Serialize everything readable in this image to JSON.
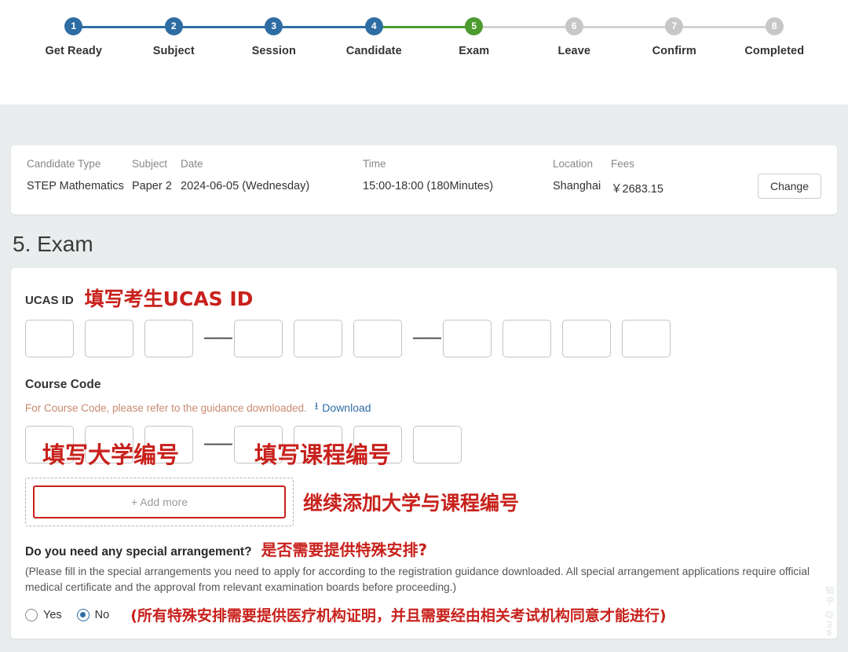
{
  "stepper": {
    "steps": [
      {
        "num": "1",
        "label": "Get Ready",
        "state": "done"
      },
      {
        "num": "2",
        "label": "Subject",
        "state": "done"
      },
      {
        "num": "3",
        "label": "Session",
        "state": "done"
      },
      {
        "num": "4",
        "label": "Candidate",
        "state": "done"
      },
      {
        "num": "5",
        "label": "Exam",
        "state": "current"
      },
      {
        "num": "6",
        "label": "Leave",
        "state": "todo"
      },
      {
        "num": "7",
        "label": "Confirm",
        "state": "todo"
      },
      {
        "num": "8",
        "label": "Completed",
        "state": "todo"
      }
    ],
    "colors": {
      "done": "#2e6da4",
      "current": "#4b9b2f",
      "todo": "#c7c7c7"
    }
  },
  "info": {
    "candidate_type_label": "Candidate Type",
    "candidate_type_value": "STEP Mathematics",
    "subject_label": "Subject",
    "subject_value": "Paper 2",
    "date_label": "Date",
    "date_value": "2024-06-05 (Wednesday)",
    "time_label": "Time",
    "time_value": "15:00-18:00 (180Minutes)",
    "location_label": "Location",
    "location_value": "Shanghai",
    "fees_label": "Fees",
    "fees_value": "￥2683.15",
    "change_button": "Change"
  },
  "section": {
    "title": "5. Exam"
  },
  "ucas": {
    "label": "UCAS ID",
    "annotation": "填写考生UCAS ID",
    "segments": [
      3,
      3,
      4
    ],
    "separator": "—",
    "values": [
      "",
      "",
      "",
      "",
      "",
      "",
      "",
      "",
      "",
      ""
    ]
  },
  "course_code": {
    "label": "Course Code",
    "hint": "For Course Code, please refer to the guidance downloaded.",
    "download_label": "Download",
    "download_icon": "download-icon",
    "segments": [
      3,
      4
    ],
    "separator": "—",
    "values": [
      "",
      "",
      "",
      "",
      "",
      "",
      ""
    ],
    "annotation_university": "填写大学编号",
    "annotation_course": "填写课程编号"
  },
  "add_more": {
    "button_label": "+ Add more",
    "annotation": "继续添加大学与课程编号"
  },
  "special_arrangement": {
    "question": "Do you need any special arrangement?",
    "question_annotation": "是否需要提供特殊安排?",
    "note": "(Please fill in the special arrangements you need to apply for according to the registration guidance downloaded. All special arrangement applications require official medical certificate and the approval from relevant examination boards before proceeding.)",
    "option_yes": "Yes",
    "option_no": "No",
    "selected": "No",
    "radio_annotation": "(所有特殊安排需要提供医疗机构证明，并且需要经由相关考试机构同意才能进行)"
  },
  "watermark": {
    "text": "知乎 @mw"
  },
  "theme": {
    "accent_blue": "#2e6da4",
    "accent_green": "#4b9b2f",
    "annotation_red": "#c8211c",
    "page_bg": "#e9eded",
    "card_bg": "#ffffff"
  }
}
